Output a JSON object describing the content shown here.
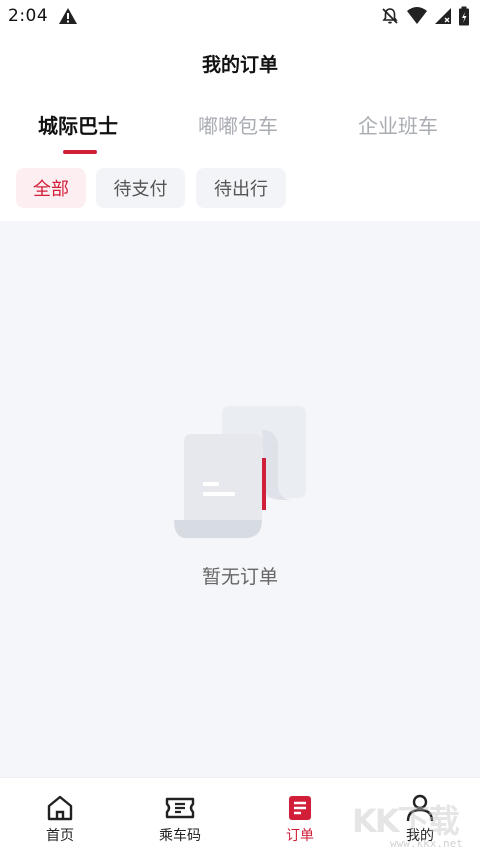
{
  "status_bar": {
    "time": "2:04"
  },
  "header": {
    "title": "我的订单"
  },
  "top_tabs": [
    {
      "label": "城际巴士",
      "active": true
    },
    {
      "label": "嘟嘟包车",
      "active": false
    },
    {
      "label": "企业班车",
      "active": false
    }
  ],
  "filters": [
    {
      "label": "全部",
      "active": true
    },
    {
      "label": "待支付",
      "active": false
    },
    {
      "label": "待出行",
      "active": false
    }
  ],
  "empty_state": {
    "text": "暂无订单"
  },
  "bottom_nav": [
    {
      "label": "首页",
      "icon": "home-icon",
      "active": false
    },
    {
      "label": "乘车码",
      "icon": "ticket-icon",
      "active": false
    },
    {
      "label": "订单",
      "icon": "order-icon",
      "active": true
    },
    {
      "label": "我的",
      "icon": "profile-icon",
      "active": false
    }
  ],
  "watermark": {
    "letters": "KK下载",
    "url": "www.kkx.net"
  },
  "colors": {
    "accent": "#d11f3a",
    "chip_active_bg": "#fdeff1",
    "chip_inactive_bg": "#f3f4f7",
    "content_bg": "#f5f6f9",
    "inactive_text": "#a9acb3"
  }
}
